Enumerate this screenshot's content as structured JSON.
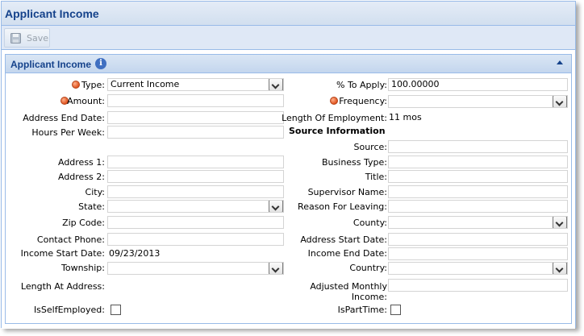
{
  "window": {
    "title": "Applicant Income"
  },
  "toolbar": {
    "save_label": "Save"
  },
  "panel": {
    "title": "Applicant Income"
  },
  "form": {
    "type": {
      "label": "Type:",
      "value": "Current Income"
    },
    "amount": {
      "label": "Amount:",
      "value": ""
    },
    "address_end_date": {
      "label": "Address End Date:",
      "value": ""
    },
    "hours_per_week": {
      "label": "Hours Per Week:",
      "value": ""
    },
    "address1": {
      "label": "Address 1:",
      "value": ""
    },
    "address2": {
      "label": "Address 2:",
      "value": ""
    },
    "city": {
      "label": "City:",
      "value": ""
    },
    "state": {
      "label": "State:",
      "value": ""
    },
    "zip_code": {
      "label": "Zip Code:",
      "value": ""
    },
    "contact_phone": {
      "label": "Contact Phone:",
      "value": ""
    },
    "income_start_date": {
      "label": "Income Start Date:",
      "value": "09/23/2013"
    },
    "township": {
      "label": "Township:",
      "value": ""
    },
    "length_at_address": {
      "label": "Length At Address:",
      "value": ""
    },
    "is_self_employed": {
      "label": "IsSelfEmployed:",
      "checked": false
    },
    "percent_to_apply": {
      "label": "% To Apply:",
      "value": "100.00000"
    },
    "frequency": {
      "label": "Frequency:",
      "value": ""
    },
    "length_of_employment": {
      "label": "Length Of Employment:",
      "value": "11 mos"
    },
    "source_information_heading": "Source Information",
    "source": {
      "label": "Source:",
      "value": ""
    },
    "business_type": {
      "label": "Business Type:",
      "value": ""
    },
    "title": {
      "label": "Title:",
      "value": ""
    },
    "supervisor_name": {
      "label": "Supervisor Name:",
      "value": ""
    },
    "reason_for_leaving": {
      "label": "Reason For Leaving:",
      "value": ""
    },
    "county": {
      "label": "County:",
      "value": ""
    },
    "address_start_date": {
      "label": "Address Start Date:",
      "value": ""
    },
    "income_end_date": {
      "label": "Income End Date:",
      "value": ""
    },
    "country": {
      "label": "Country:",
      "value": ""
    },
    "adjusted_monthly_income": {
      "label_line1": "Adjusted Monthly",
      "label_line2": "Income:",
      "value": ""
    },
    "is_part_time": {
      "label": "IsPartTime:",
      "checked": false
    }
  },
  "icons": {
    "save": "floppy-disk-icon",
    "info": "info-icon",
    "collapse": "chevron-up-icon",
    "required": "required-dot-icon",
    "dropdown": "chevron-down-icon"
  },
  "colors": {
    "title_text": "#15428b",
    "panel_border": "#99bbe8",
    "required_dot": "#e0531f"
  }
}
